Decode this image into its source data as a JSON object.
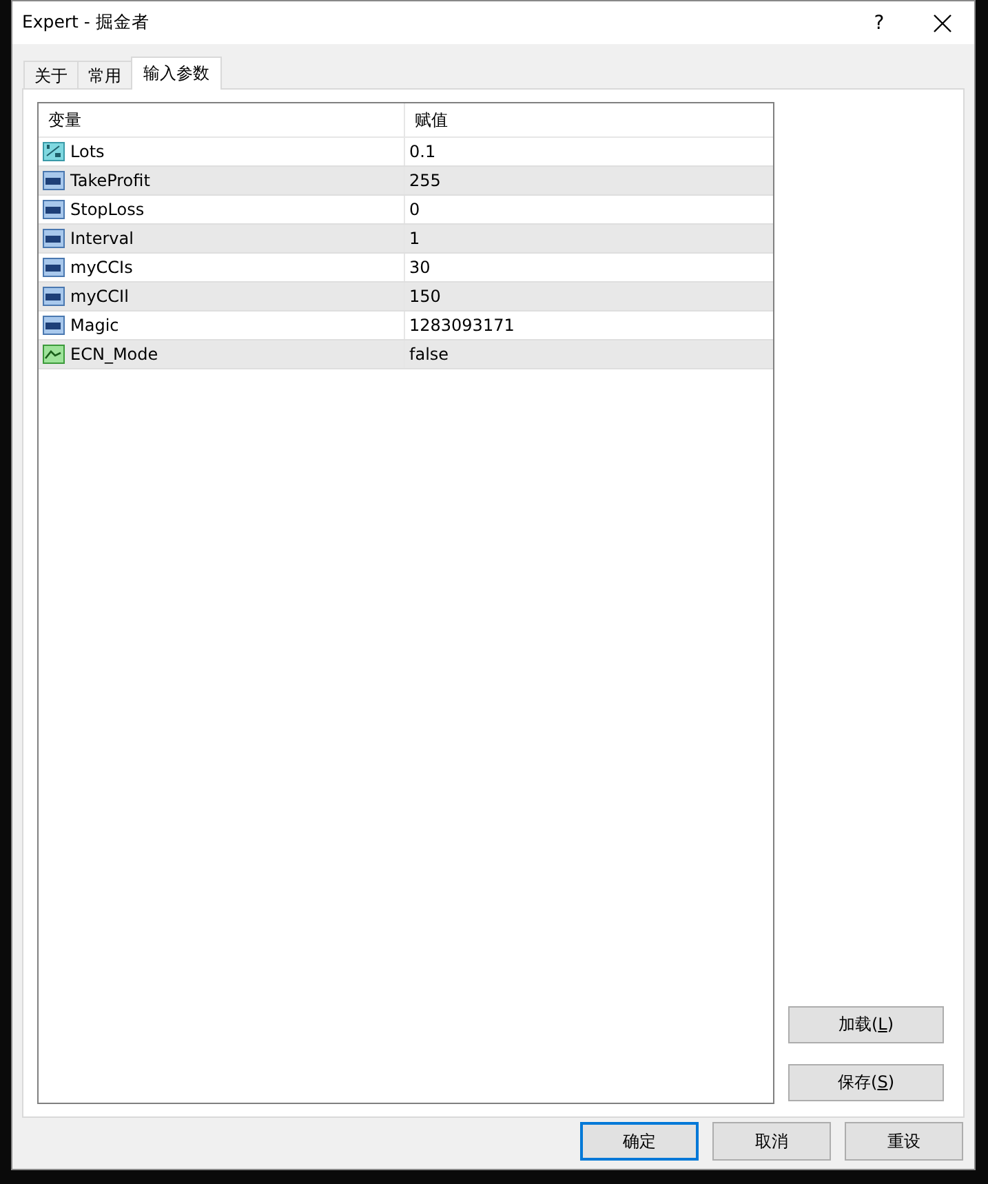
{
  "window": {
    "title": "Expert - 掘金者",
    "help": "?"
  },
  "tabs": [
    {
      "label": "关于",
      "selected": false
    },
    {
      "label": "常用",
      "selected": false
    },
    {
      "label": "输入参数",
      "selected": true
    }
  ],
  "table": {
    "columns": [
      "变量",
      "赋值"
    ],
    "rows": [
      {
        "kind": "double",
        "name": "Lots",
        "value": "0.1"
      },
      {
        "kind": "int",
        "name": "TakeProfit",
        "value": "255"
      },
      {
        "kind": "int",
        "name": "StopLoss",
        "value": "0"
      },
      {
        "kind": "int",
        "name": "Interval",
        "value": "1"
      },
      {
        "kind": "int",
        "name": "myCCIs",
        "value": "30"
      },
      {
        "kind": "int",
        "name": "myCCIl",
        "value": "150"
      },
      {
        "kind": "int",
        "name": "Magic",
        "value": "1283093171"
      },
      {
        "kind": "bool",
        "name": "ECN_Mode",
        "value": "false"
      }
    ]
  },
  "side_buttons": [
    {
      "label": "加载(**L**)"
    },
    {
      "label": "保存(**S**)"
    }
  ],
  "buttons": [
    {
      "label": "确定",
      "focused": true
    },
    {
      "label": "取消",
      "focused": false
    },
    {
      "label": "重设",
      "focused": false
    }
  ]
}
